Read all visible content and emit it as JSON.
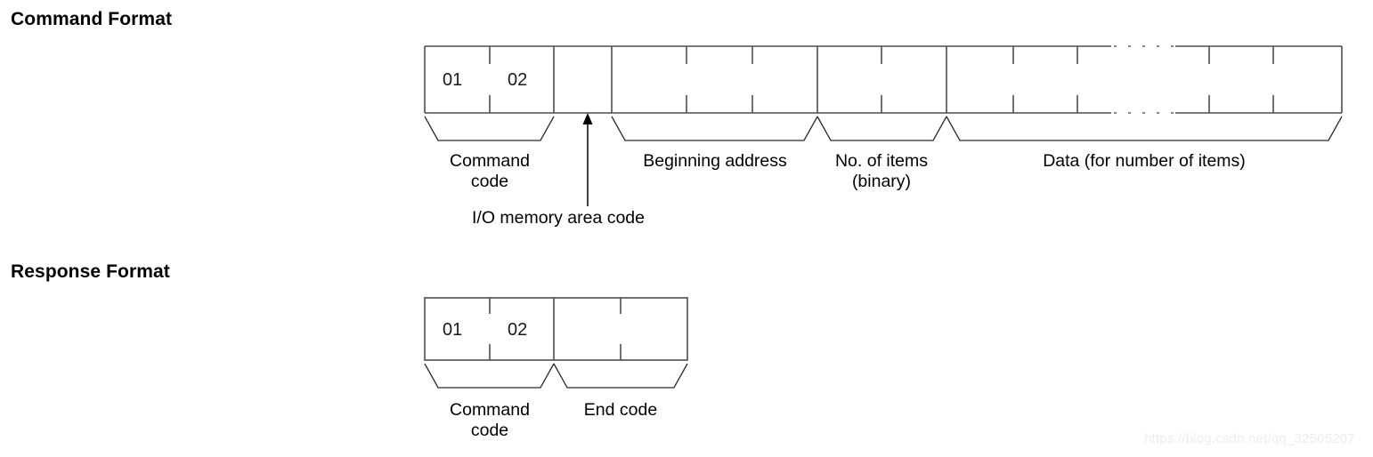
{
  "page": {
    "watermark": "https://blog.csdn.net/qq_32505207"
  },
  "command_format": {
    "title": "Command Format",
    "cells": [
      {
        "value": "01"
      },
      {
        "value": "02"
      }
    ],
    "fields": [
      {
        "name": "command-code",
        "label_line1": "Command",
        "label_line2": "code"
      },
      {
        "name": "io-memory-area-code",
        "label_line1": "I/O memory area code",
        "label_line2": ""
      },
      {
        "name": "beginning-address",
        "label_line1": "Beginning address",
        "label_line2": ""
      },
      {
        "name": "no-of-items",
        "label_line1": "No. of items",
        "label_line2": "(binary)"
      },
      {
        "name": "data",
        "label_line1": "Data (for number of items)",
        "label_line2": ""
      }
    ]
  },
  "response_format": {
    "title": "Response Format",
    "cells": [
      {
        "value": "01"
      },
      {
        "value": "02"
      }
    ],
    "fields": [
      {
        "name": "command-code",
        "label_line1": "Command",
        "label_line2": "code"
      },
      {
        "name": "end-code",
        "label_line1": "End code",
        "label_line2": ""
      }
    ]
  }
}
